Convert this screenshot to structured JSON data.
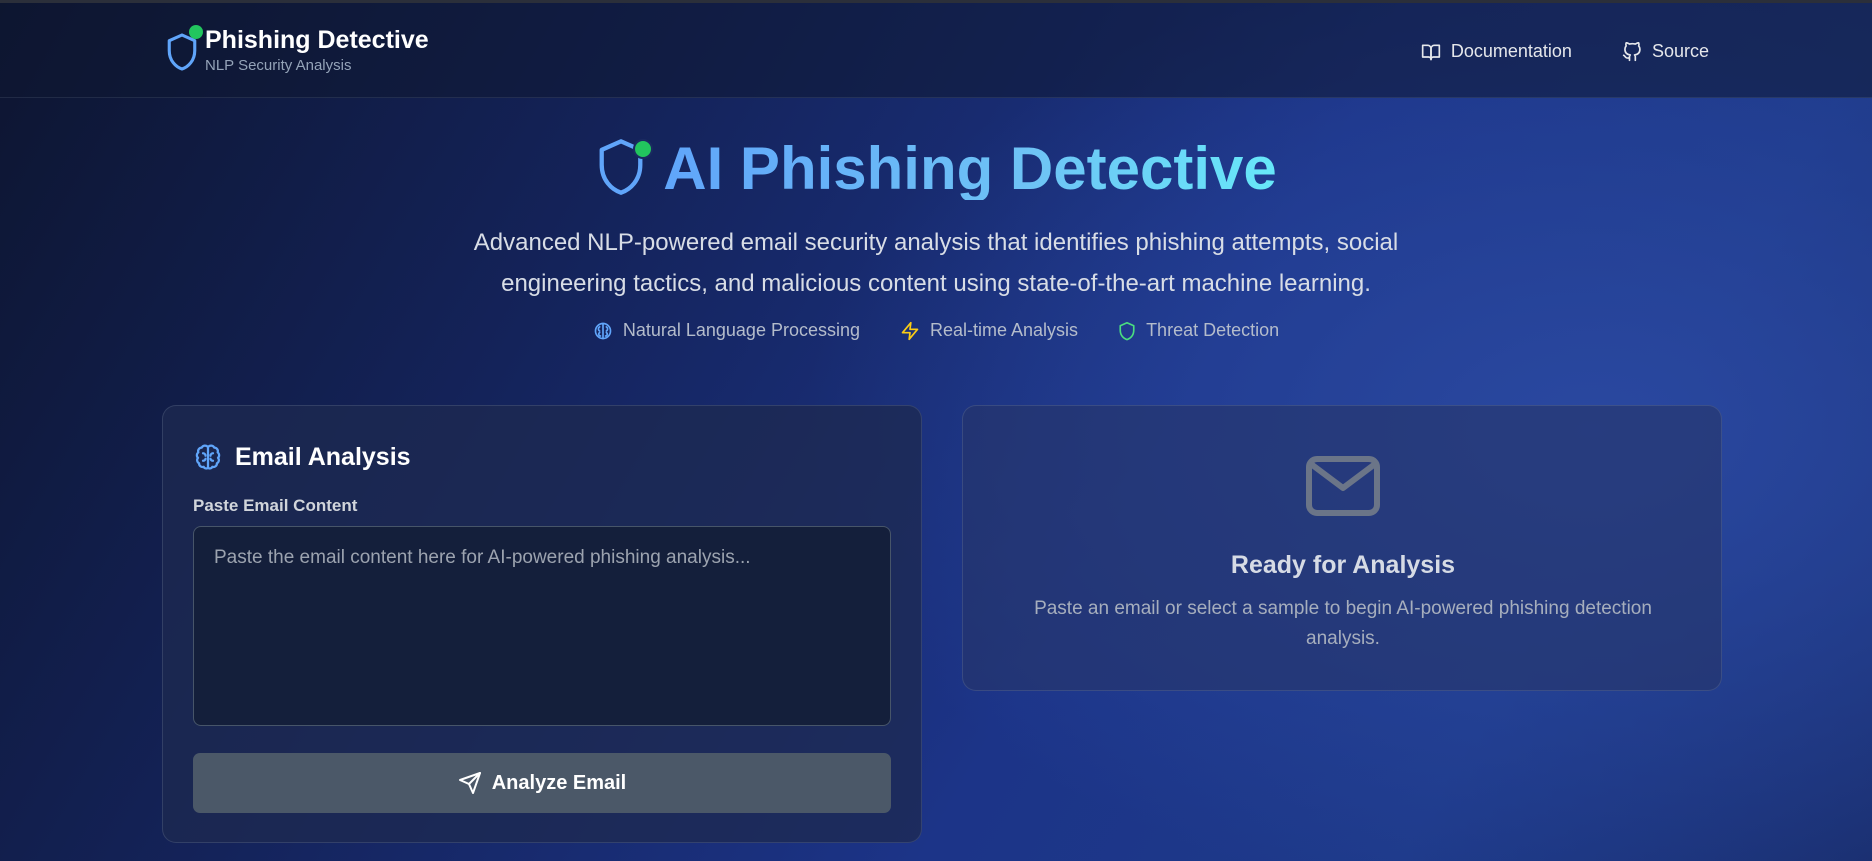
{
  "header": {
    "brand_title": "Phishing Detective",
    "brand_subtitle": "NLP Security Analysis",
    "nav": [
      {
        "label": "Documentation",
        "icon": "book-icon"
      },
      {
        "label": "Source",
        "icon": "github-icon"
      }
    ]
  },
  "hero": {
    "title": "AI Phishing Detective",
    "description": "Advanced NLP-powered email security analysis that identifies phishing attempts, social engineering tactics, and malicious content using state-of-the-art machine learning.",
    "features": [
      {
        "label": "Natural Language Processing",
        "icon": "brain-icon",
        "color": "#60a5fa"
      },
      {
        "label": "Real-time Analysis",
        "icon": "zap-icon",
        "color": "#facc15"
      },
      {
        "label": "Threat Detection",
        "icon": "shield-icon",
        "color": "#4ade80"
      }
    ]
  },
  "analysis_card": {
    "title": "Email Analysis",
    "field_label": "Paste Email Content",
    "placeholder": "Paste the email content here for AI-powered phishing analysis...",
    "value": "",
    "button_label": "Analyze Email"
  },
  "result_card": {
    "title": "Ready for Analysis",
    "description": "Paste an email or select a sample to begin AI-powered phishing detection analysis."
  },
  "colors": {
    "accent": "#60a5fa",
    "status_dot": "#22c55e"
  }
}
